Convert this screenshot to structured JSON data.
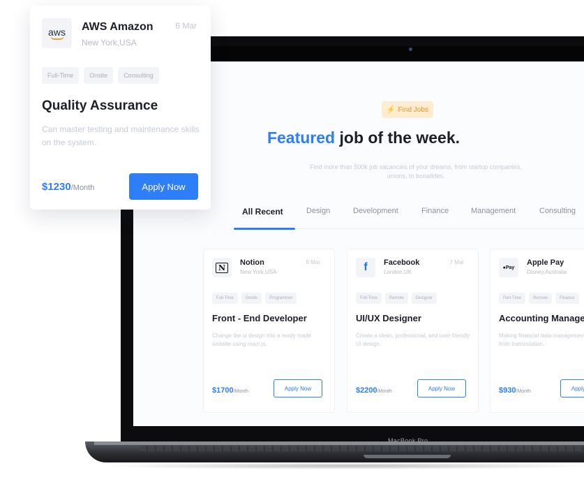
{
  "colors": {
    "accent": "#2d7ef7",
    "badge_bg": "#fdeccf",
    "badge_text": "#e4982a"
  },
  "laptop": {
    "model_label": "MacBook Pro"
  },
  "hero": {
    "badge": {
      "icon": "lightning-icon",
      "glyph": "⚡",
      "label": "Find Jobs"
    },
    "headline_accent": "Featured",
    "headline_rest": " job of the week.",
    "subtitle": "Find more than 500k job vacancies of your dreams, from startup companies, unions, to bonafides."
  },
  "tabs": [
    "All Recent",
    "Design",
    "Development",
    "Finance",
    "Management",
    "Consulting"
  ],
  "active_tab": "All Recent",
  "jobs": [
    {
      "company": "Notion",
      "location": "New York,USA",
      "date": "6 Mar",
      "logo_icon": "notion-logo-icon",
      "logo_glyph": "N",
      "tags": [
        "Full-Time",
        "Onsite",
        "Programmer"
      ],
      "title": "Front - End Developer",
      "description": "Change the ui design into a ready made website using react js.",
      "price": "$1700",
      "period": "/Month",
      "apply_label": "Apply Now"
    },
    {
      "company": "Facebook",
      "location": "London,UK",
      "date": "7 Mar",
      "logo_icon": "facebook-logo-icon",
      "logo_glyph": "f",
      "tags": [
        "Full-Time",
        "Remote",
        "Designer"
      ],
      "title": "UI/UX Designer",
      "description": "Create a clean, professional, and user-friendly UI design.",
      "price": "$2200",
      "period": "/Month",
      "apply_label": "Apply Now"
    },
    {
      "company": "Apple Pay",
      "location": "Disney,Australia",
      "date": "",
      "logo_icon": "apple-pay-logo-icon",
      "logo_glyph": "Pay",
      "tags": [
        "Part-Time",
        "Remote",
        "Finance"
      ],
      "title": "Accounting Manager",
      "description": "Making financial data management starting from transmission.",
      "price": "$930",
      "period": "/Month",
      "apply_label": "Apply Now"
    }
  ],
  "featured_card": {
    "company": "AWS Amazon",
    "location": "New York,USA",
    "date": "6 Mar",
    "logo_icon": "aws-logo-icon",
    "logo_text": "aws",
    "tags": [
      "Full-Time",
      "Onsite",
      "Consulting"
    ],
    "title": "Quality Assurance",
    "description": "Can master testing and maintenance skills on the system.",
    "price": "$1230",
    "period": "/Month",
    "apply_label": "Apply Now"
  }
}
